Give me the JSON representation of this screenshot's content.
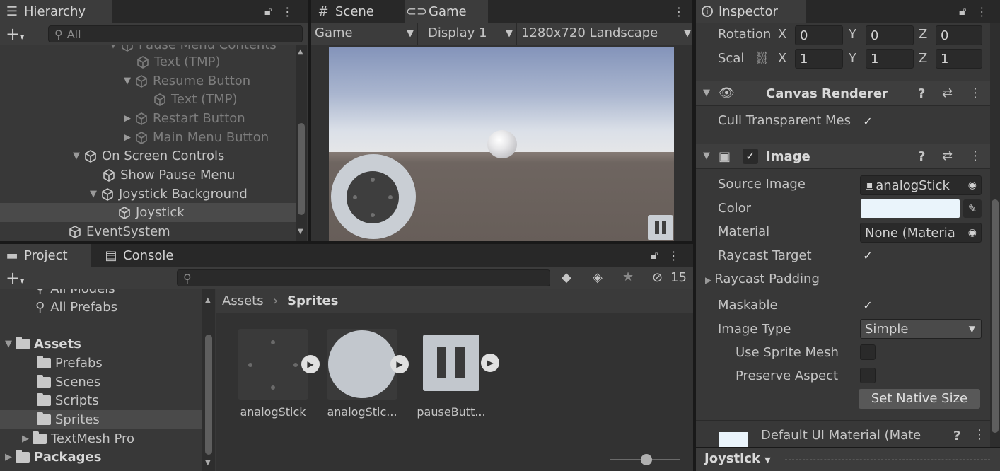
{
  "hierarchy": {
    "tab_label": "Hierarchy",
    "search_placeholder": "All",
    "items": [
      {
        "label": "Pause Menu Contents",
        "dim": true
      },
      {
        "label": "Text (TMP)",
        "dim": true
      },
      {
        "label": "Resume Button",
        "dim": true
      },
      {
        "label": "Text (TMP)",
        "dim": true
      },
      {
        "label": "Restart Button",
        "dim": true
      },
      {
        "label": "Main Menu Button",
        "dim": true
      },
      {
        "label": "On Screen Controls",
        "dim": false
      },
      {
        "label": "Show Pause Menu",
        "dim": false
      },
      {
        "label": "Joystick Background",
        "dim": false
      },
      {
        "label": "Joystick",
        "dim": false,
        "selected": true
      },
      {
        "label": "EventSystem",
        "dim": false
      }
    ]
  },
  "scene_tab": {
    "label": "Scene"
  },
  "game_tab": {
    "label": "Game"
  },
  "game_toolbar": {
    "mode": "Game",
    "display": "Display 1",
    "resolution": "1280x720 Landscape"
  },
  "inspector": {
    "tab_label": "Inspector",
    "rotation": {
      "label": "Rotation",
      "x": "0",
      "y": "0",
      "z": "0"
    },
    "scale": {
      "label": "Scal",
      "x": "1",
      "y": "1",
      "z": "1"
    },
    "axis_labels": {
      "x": "X",
      "y": "Y",
      "z": "Z"
    },
    "canvas_renderer": {
      "title": "Canvas Renderer",
      "cull_label": "Cull Transparent Mes",
      "cull_checked": "✓"
    },
    "image": {
      "title": "Image",
      "source_image_label": "Source Image",
      "source_image_value": "analogStick",
      "color_label": "Color",
      "color_value": "#eaf4fb",
      "material_label": "Material",
      "material_value": "None (Materia",
      "raycast_target_label": "Raycast Target",
      "raycast_target_checked": "✓",
      "raycast_padding_label": "Raycast Padding",
      "maskable_label": "Maskable",
      "maskable_checked": "✓",
      "image_type_label": "Image Type",
      "image_type_value": "Simple",
      "use_sprite_mesh_label": "Use Sprite Mesh",
      "preserve_aspect_label": "Preserve Aspect",
      "set_native_size_label": "Set Native Size"
    },
    "material_footer": "Default UI Material (Mate",
    "footer_object": "Joystick"
  },
  "project": {
    "tab_label": "Project",
    "console_tab_label": "Console",
    "hidden_count": "15",
    "tree": [
      {
        "label": "All Models",
        "type": "search",
        "indent": 1
      },
      {
        "label": "All Prefabs",
        "type": "search",
        "indent": 1
      },
      {
        "label": "Assets",
        "type": "folder-open",
        "indent": 0,
        "bold": true
      },
      {
        "label": "Prefabs",
        "type": "folder",
        "indent": 2
      },
      {
        "label": "Scenes",
        "type": "folder",
        "indent": 2
      },
      {
        "label": "Scripts",
        "type": "folder",
        "indent": 2
      },
      {
        "label": "Sprites",
        "type": "folder",
        "indent": 2,
        "selected": true
      },
      {
        "label": "TextMesh Pro",
        "type": "folder",
        "indent": 2,
        "collapsed": true
      },
      {
        "label": "Packages",
        "type": "folder",
        "indent": 0,
        "bold": true,
        "collapsed": true
      }
    ],
    "breadcrumb": {
      "root": "Assets",
      "current": "Sprites"
    },
    "assets": [
      {
        "name": "analogStick"
      },
      {
        "name": "analogStic..."
      },
      {
        "name": "pauseButt..."
      }
    ]
  }
}
